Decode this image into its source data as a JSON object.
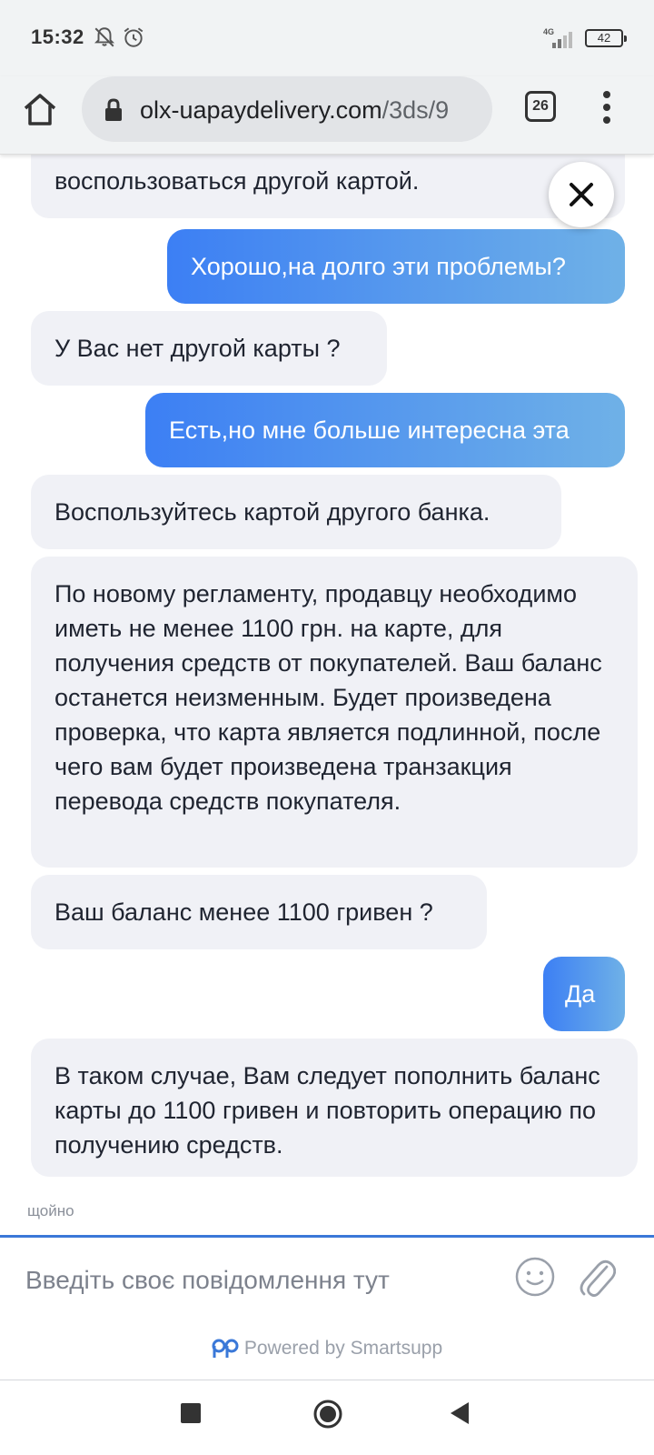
{
  "status_bar": {
    "time": "15:32",
    "network": "4G",
    "battery": "42",
    "icons": [
      "notifications-off-icon",
      "alarm-icon",
      "signal-icon",
      "battery-icon"
    ]
  },
  "browser": {
    "url_host": "olx-uapaydelivery.com",
    "url_path": "/3ds/9",
    "tab_count": "26",
    "icons": [
      "home-icon",
      "lock-icon",
      "tabs-icon",
      "more-vert-icon"
    ]
  },
  "chat": {
    "messages": [
      {
        "from": "agent",
        "text": "воспользоваться другой картой."
      },
      {
        "from": "user",
        "text": "Хорошо,на долго эти проблемы?"
      },
      {
        "from": "agent",
        "text": "У Вас нет другой карты ?"
      },
      {
        "from": "user",
        "text": "Есть,но мне больше интересна эта"
      },
      {
        "from": "agent",
        "text": "Воспользуйтесь картой другого банка."
      },
      {
        "from": "agent",
        "text": "По новому регламенту, продавцу необходимо иметь не менее 1100 грн. на карте, для получения средств от покупателей. Ваш баланс останется неизменным. Будет произведена проверка, что карта является подлинной, после чего вам будет произведена транзакция перевода средств покупателя."
      },
      {
        "from": "agent",
        "text": "Ваш баланс менее 1100 гривен ?"
      },
      {
        "from": "user",
        "text": "Да"
      },
      {
        "from": "agent",
        "text": "В таком случае, Вам следует пополнить баланс карты до 1100 гривен и повторить операцию по получению средств."
      }
    ],
    "seen_label": "щойно"
  },
  "composer": {
    "placeholder": "Введіть своє повідомлення тут",
    "powered_by": "Powered by Smartsupp"
  },
  "colors": {
    "user_gradient_start": "#3c7ff4",
    "user_gradient_end": "#6fb1e7",
    "agent_bubble": "#f0f1f6",
    "accent": "#3a78d8"
  }
}
